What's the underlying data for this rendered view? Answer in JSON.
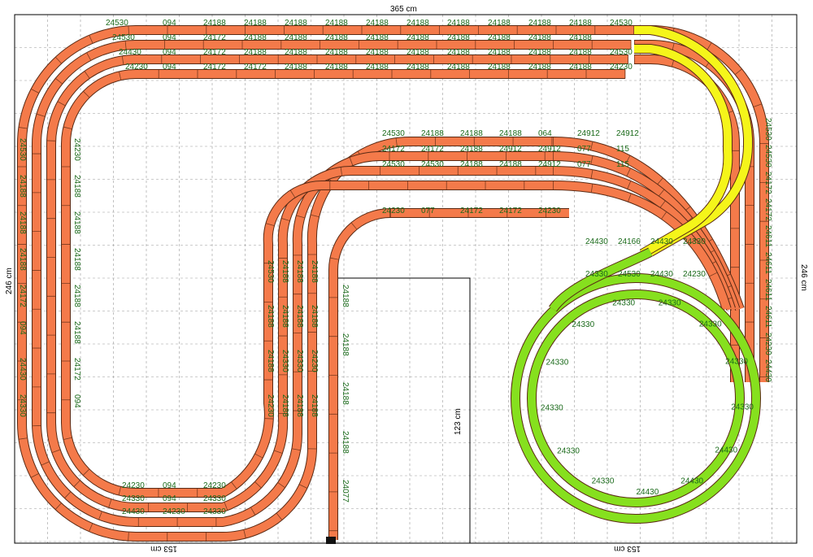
{
  "dimensions": {
    "top_width": "365 cm",
    "left_height": "246 cm",
    "right_height": "246 cm",
    "inner_height": "123 cm",
    "bottom_left": "153 cm",
    "bottom_right": "153 cm"
  },
  "colors": {
    "track": "#f47a4a",
    "track_edge": "#5a2a14",
    "helix_yellow": "#f5f51a",
    "helix_green": "#86e01e",
    "grid": "#9a9a9a",
    "label": "#1a6a1a"
  },
  "labels": {
    "top_row1": [
      "24530",
      "094",
      "24188",
      "24188",
      "24188",
      "24188",
      "24188",
      "24188",
      "24188",
      "24188",
      "24188",
      "24188",
      "24530"
    ],
    "top_row2": [
      "24530",
      "094",
      "24172",
      "24188",
      "24188",
      "24188",
      "24188",
      "24188",
      "24188",
      "24188",
      "24188",
      "24188"
    ],
    "top_row3": [
      "24430",
      "094",
      "24172",
      "24188",
      "24188",
      "24188",
      "24188",
      "24188",
      "24188",
      "24188",
      "24188",
      "24188",
      "24530"
    ],
    "top_row4": [
      "24230",
      "094",
      "24172",
      "24172",
      "24188",
      "24188",
      "24188",
      "24188",
      "24188",
      "24188",
      "24188",
      "24188",
      "24230"
    ],
    "inner_row1": [
      "24530",
      "24188",
      "24188",
      "24188",
      "064",
      "24912",
      "24912"
    ],
    "inner_row2": [
      "24172",
      "24172",
      "24188",
      "24912",
      "24912",
      "077",
      "115"
    ],
    "inner_row3": [
      "24530",
      "24530",
      "24188",
      "24188",
      "24912",
      "077",
      "115"
    ],
    "inner_row4": [
      "24230",
      "077",
      "24172",
      "24172",
      "24230"
    ],
    "left_column": [
      "24530",
      "24188",
      "24188",
      "24188",
      "24172",
      "094",
      "24430",
      "24330",
      "24230",
      "24188",
      "24188",
      "24188",
      "24188",
      "24188",
      "24172",
      "094"
    ],
    "inner_left_column": [
      "24530",
      "24188",
      "24188",
      "24188",
      "24188",
      "24188",
      "24188",
      "24188",
      "24188",
      "24330",
      "24330",
      "24230",
      "24230",
      "24188",
      "24188",
      "24188"
    ],
    "bottom_labels": [
      "24230",
      "094",
      "24230",
      "24330",
      "094",
      "24330",
      "24430",
      "24230",
      "24330"
    ],
    "right_column": [
      "24530",
      "24530",
      "24172",
      "24172",
      "24611",
      "24611",
      "24611",
      "24611",
      "24230",
      "24430"
    ],
    "helix_labels": [
      "24430",
      "24430",
      "24430",
      "24330",
      "24330",
      "24330",
      "24330",
      "24330",
      "24330",
      "24330",
      "24330",
      "24330",
      "24330"
    ],
    "crossover_labels": [
      "24430",
      "24166",
      "24430",
      "24330",
      "24330",
      "24530",
      "24430",
      "24230"
    ],
    "stub_labels": [
      "24188",
      "24188",
      "24188",
      "24188",
      "24077"
    ]
  }
}
